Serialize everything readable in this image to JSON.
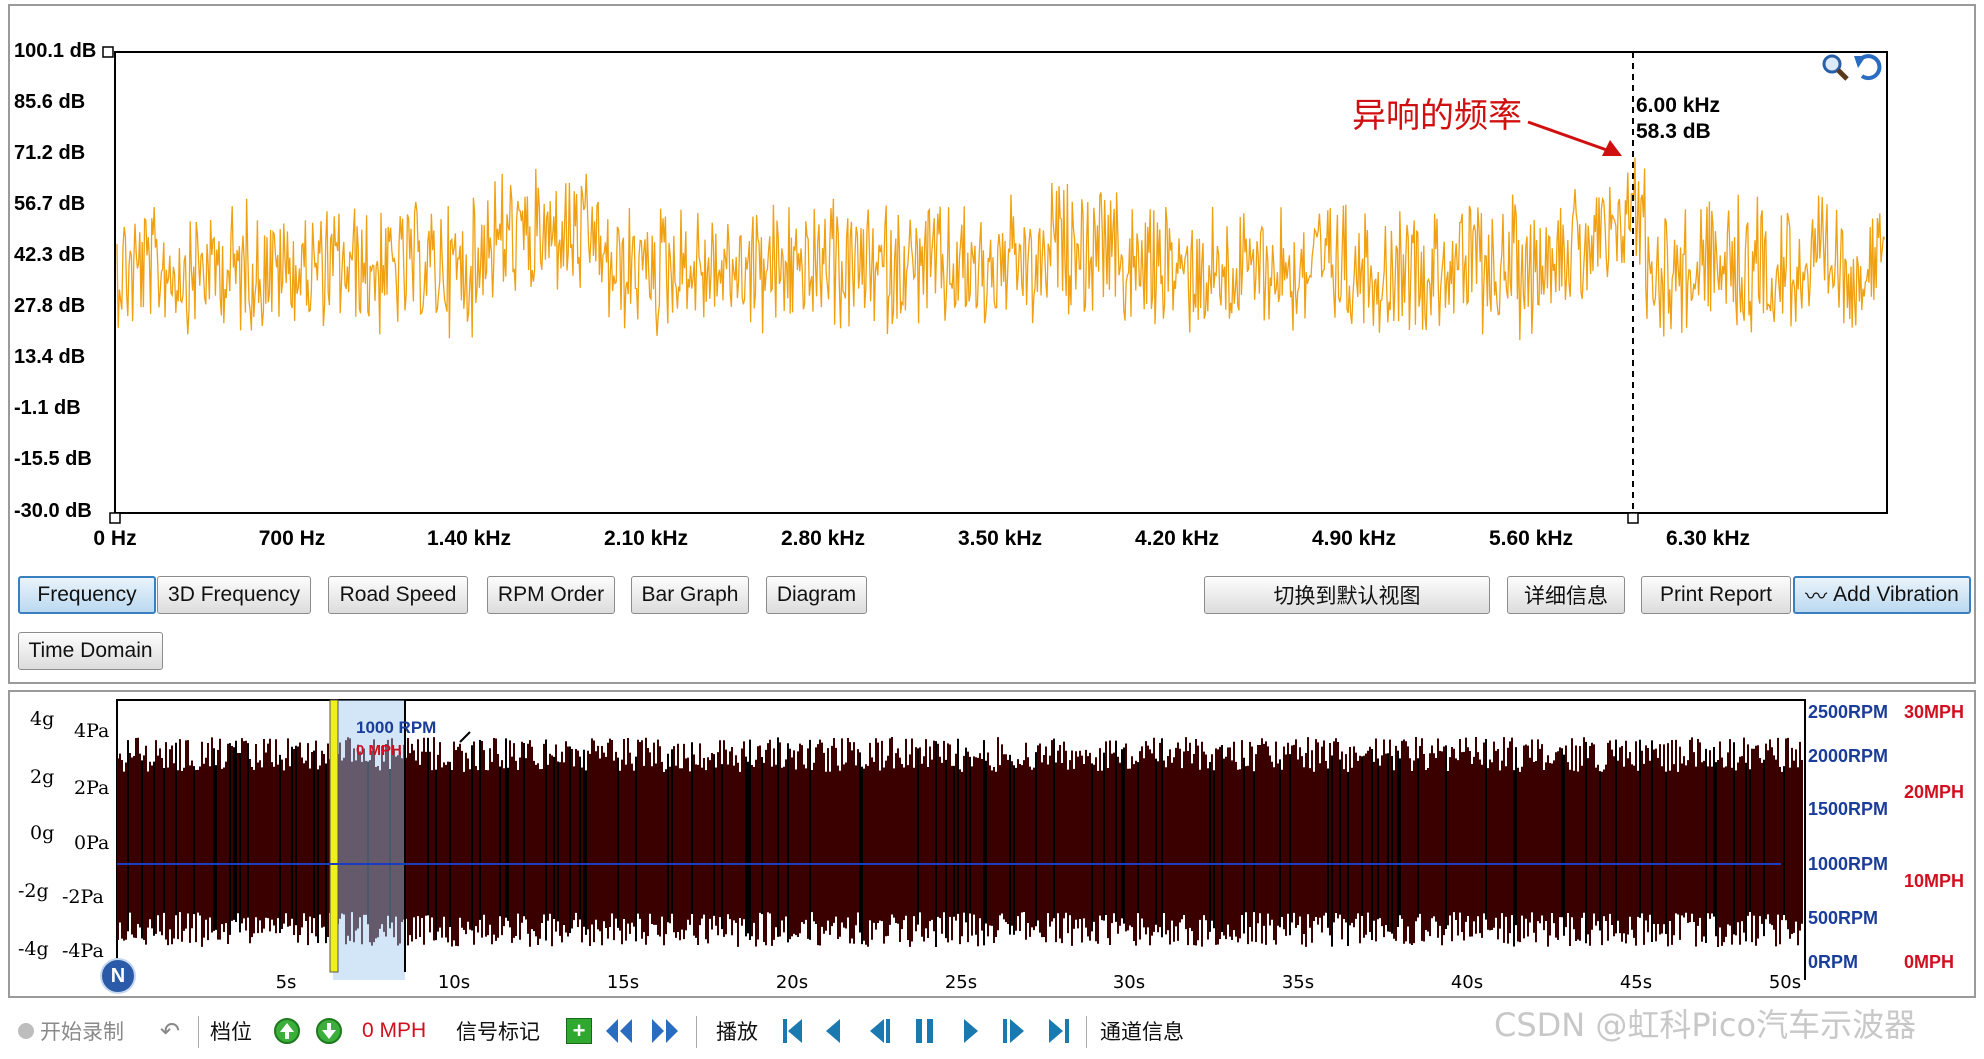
{
  "frequency_chart": {
    "y_ticks": [
      "100.1 dB",
      "85.6 dB",
      "71.2 dB",
      "56.7 dB",
      "42.3 dB",
      "27.8 dB",
      "13.4 dB",
      "-1.1 dB",
      "-15.5 dB",
      "-30.0 dB"
    ],
    "x_ticks": [
      "0 Hz",
      "700 Hz",
      "1.40 kHz",
      "2.10 kHz",
      "2.80 kHz",
      "3.50 kHz",
      "4.20 kHz",
      "4.90 kHz",
      "5.60 kHz",
      "6.30 kHz"
    ],
    "annotation": "异响的频率",
    "cursor_freq": "6.00 kHz",
    "cursor_db": "58.3 dB",
    "trace_color": "#f0a010",
    "annotation_color": "#d01010"
  },
  "view_buttons": {
    "frequency": "Frequency",
    "frequency_3d": "3D Frequency",
    "road_speed": "Road Speed",
    "rpm_order": "RPM Order",
    "bar_graph": "Bar Graph",
    "diagram": "Diagram",
    "time_domain": "Time Domain"
  },
  "action_buttons": {
    "default_view": "切换到默认视图",
    "details": "详细信息",
    "print_report": "Print Report",
    "add_vibration": "Add Vibration"
  },
  "time_chart": {
    "g_ticks": [
      "4g",
      "2g",
      "0g",
      "-2g",
      "-4g"
    ],
    "pa_ticks": [
      "4Pa",
      "2Pa",
      "0Pa",
      "-2Pa",
      "-4Pa"
    ],
    "rpm_ticks": [
      "2500RPM",
      "2000RPM",
      "1500RPM",
      "1000RPM",
      "500RPM",
      "0RPM"
    ],
    "mph_ticks": [
      "30MPH",
      "20MPH",
      "10MPH",
      "0MPH"
    ],
    "time_ticks": [
      "5s",
      "10s",
      "15s",
      "20s",
      "25s",
      "30s",
      "35s",
      "40s",
      "45s",
      "50s"
    ],
    "marker_rpm": "1000 RPM",
    "marker_mph": "0 MPH",
    "gear_badge": "N",
    "waveform_color": "#3a0000"
  },
  "toolbar": {
    "record": "开始录制",
    "gear": "档位",
    "speed": "0 MPH",
    "signal_mark": "信号标记",
    "playback": "播放",
    "channel_info": "通道信息"
  },
  "watermark": "CSDN @虹科Pico汽车示波器"
}
